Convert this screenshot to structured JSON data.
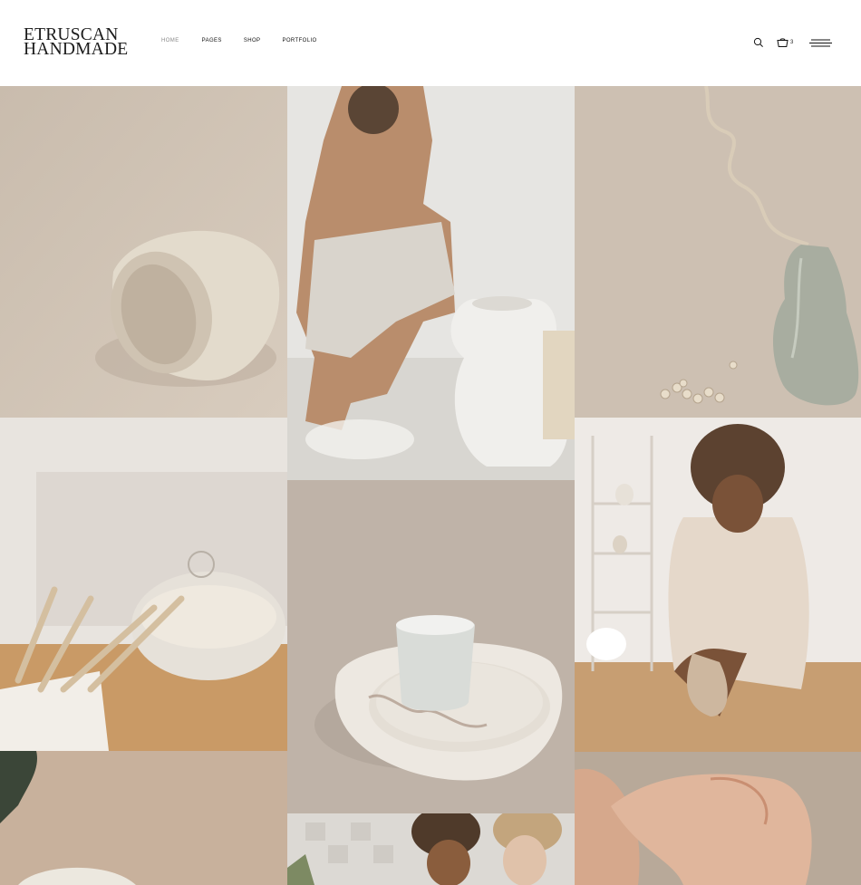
{
  "brand": {
    "line1": "ETRUSCAN",
    "line2": "HANDMADE"
  },
  "nav": {
    "items": [
      {
        "label": "HOME",
        "active": true
      },
      {
        "label": "PAGES",
        "active": false
      },
      {
        "label": "SHOP",
        "active": false
      },
      {
        "label": "PORTFOLIO",
        "active": false
      }
    ]
  },
  "header_tools": {
    "search_icon": "search-icon",
    "cart_icon": "basket-icon",
    "cart_count": "3",
    "menu_icon": "hamburger-icon"
  },
  "gallery": {
    "images": [
      {
        "name": "gallery-image-ceramic-bangle"
      },
      {
        "name": "gallery-image-woman-with-torso-vase"
      },
      {
        "name": "gallery-image-green-vase-with-branch"
      },
      {
        "name": "gallery-image-pottery-tools"
      },
      {
        "name": "gallery-image-cup-and-plates"
      },
      {
        "name": "gallery-image-potter-at-work"
      },
      {
        "name": "gallery-image-plant-leaf"
      },
      {
        "name": "gallery-image-two-women-studio"
      },
      {
        "name": "gallery-image-hand-closeup"
      }
    ]
  },
  "colors": {
    "text": "#111111",
    "nav_active": "#888888",
    "background": "#ffffff"
  }
}
